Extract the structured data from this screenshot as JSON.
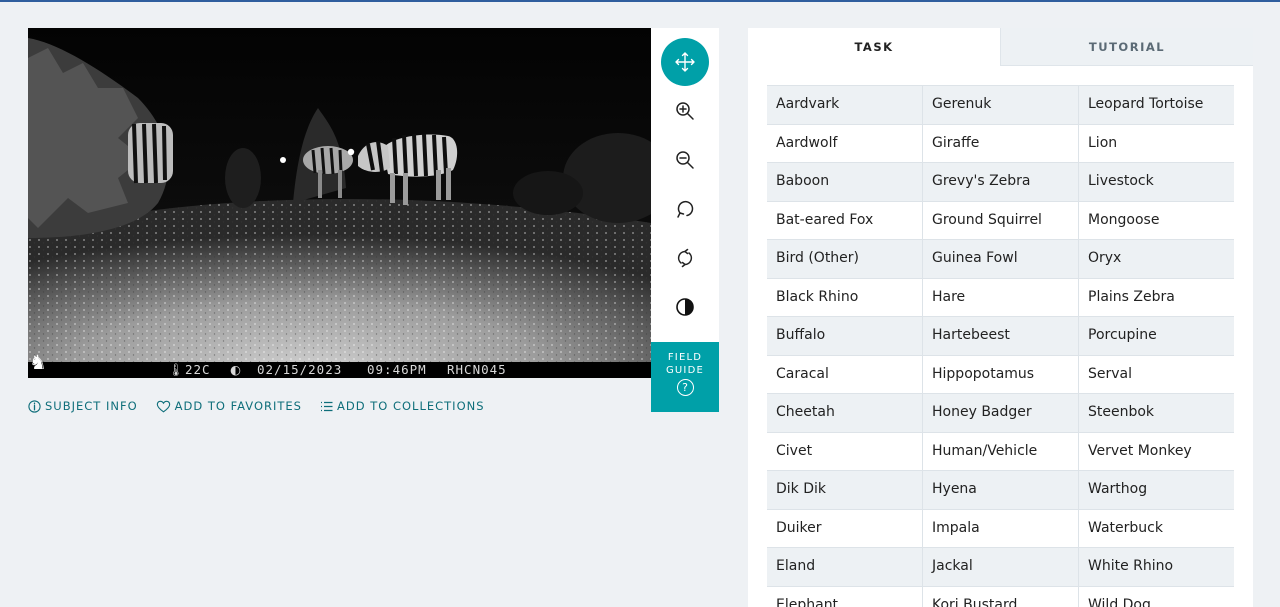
{
  "subject": {
    "image_stamp": {
      "temperature": "22C",
      "date": "02/15/2023",
      "time": "09:46PM",
      "camera_id": "RHCN045"
    }
  },
  "toolbar": {
    "tools": [
      {
        "name": "move",
        "icon": "move-icon",
        "active": true
      },
      {
        "name": "zoom-in",
        "icon": "zoom-in-icon"
      },
      {
        "name": "zoom-out",
        "icon": "zoom-out-icon"
      },
      {
        "name": "rotate",
        "icon": "rotate-icon"
      },
      {
        "name": "reset",
        "icon": "reset-icon"
      },
      {
        "name": "invert",
        "icon": "contrast-icon"
      }
    ],
    "field_guide_line1": "FIELD",
    "field_guide_line2": "GUIDE",
    "field_guide_icon": "?"
  },
  "meta": {
    "subject_info": "SUBJECT INFO",
    "add_to_favorites": "ADD TO FAVORITES",
    "add_to_collections": "ADD TO COLLECTIONS"
  },
  "tabs": {
    "task": "TASK",
    "tutorial": "TUTORIAL"
  },
  "choices": {
    "rows": [
      [
        "Aardvark",
        "Gerenuk",
        "Leopard Tortoise"
      ],
      [
        "Aardwolf",
        "Giraffe",
        "Lion"
      ],
      [
        "Baboon",
        "Grevy's Zebra",
        "Livestock"
      ],
      [
        "Bat-eared Fox",
        "Ground Squirrel",
        "Mongoose"
      ],
      [
        "Bird (Other)",
        "Guinea Fowl",
        "Oryx"
      ],
      [
        "Black Rhino",
        "Hare",
        "Plains Zebra"
      ],
      [
        "Buffalo",
        "Hartebeest",
        "Porcupine"
      ],
      [
        "Caracal",
        "Hippopotamus",
        "Serval"
      ],
      [
        "Cheetah",
        "Honey Badger",
        "Steenbok"
      ],
      [
        "Civet",
        "Human/Vehicle",
        "Vervet Monkey"
      ],
      [
        "Dik Dik",
        "Hyena",
        "Warthog"
      ],
      [
        "Duiker",
        "Impala",
        "Waterbuck"
      ],
      [
        "Eland",
        "Jackal",
        "White Rhino"
      ],
      [
        "Elephant",
        "Kori Bustard",
        "Wild Dog"
      ]
    ]
  },
  "colors": {
    "accent": "#00a0a8",
    "link": "#0e6e7a",
    "row_alt": "#edf1f4",
    "top_border": "#2f5e9e"
  }
}
